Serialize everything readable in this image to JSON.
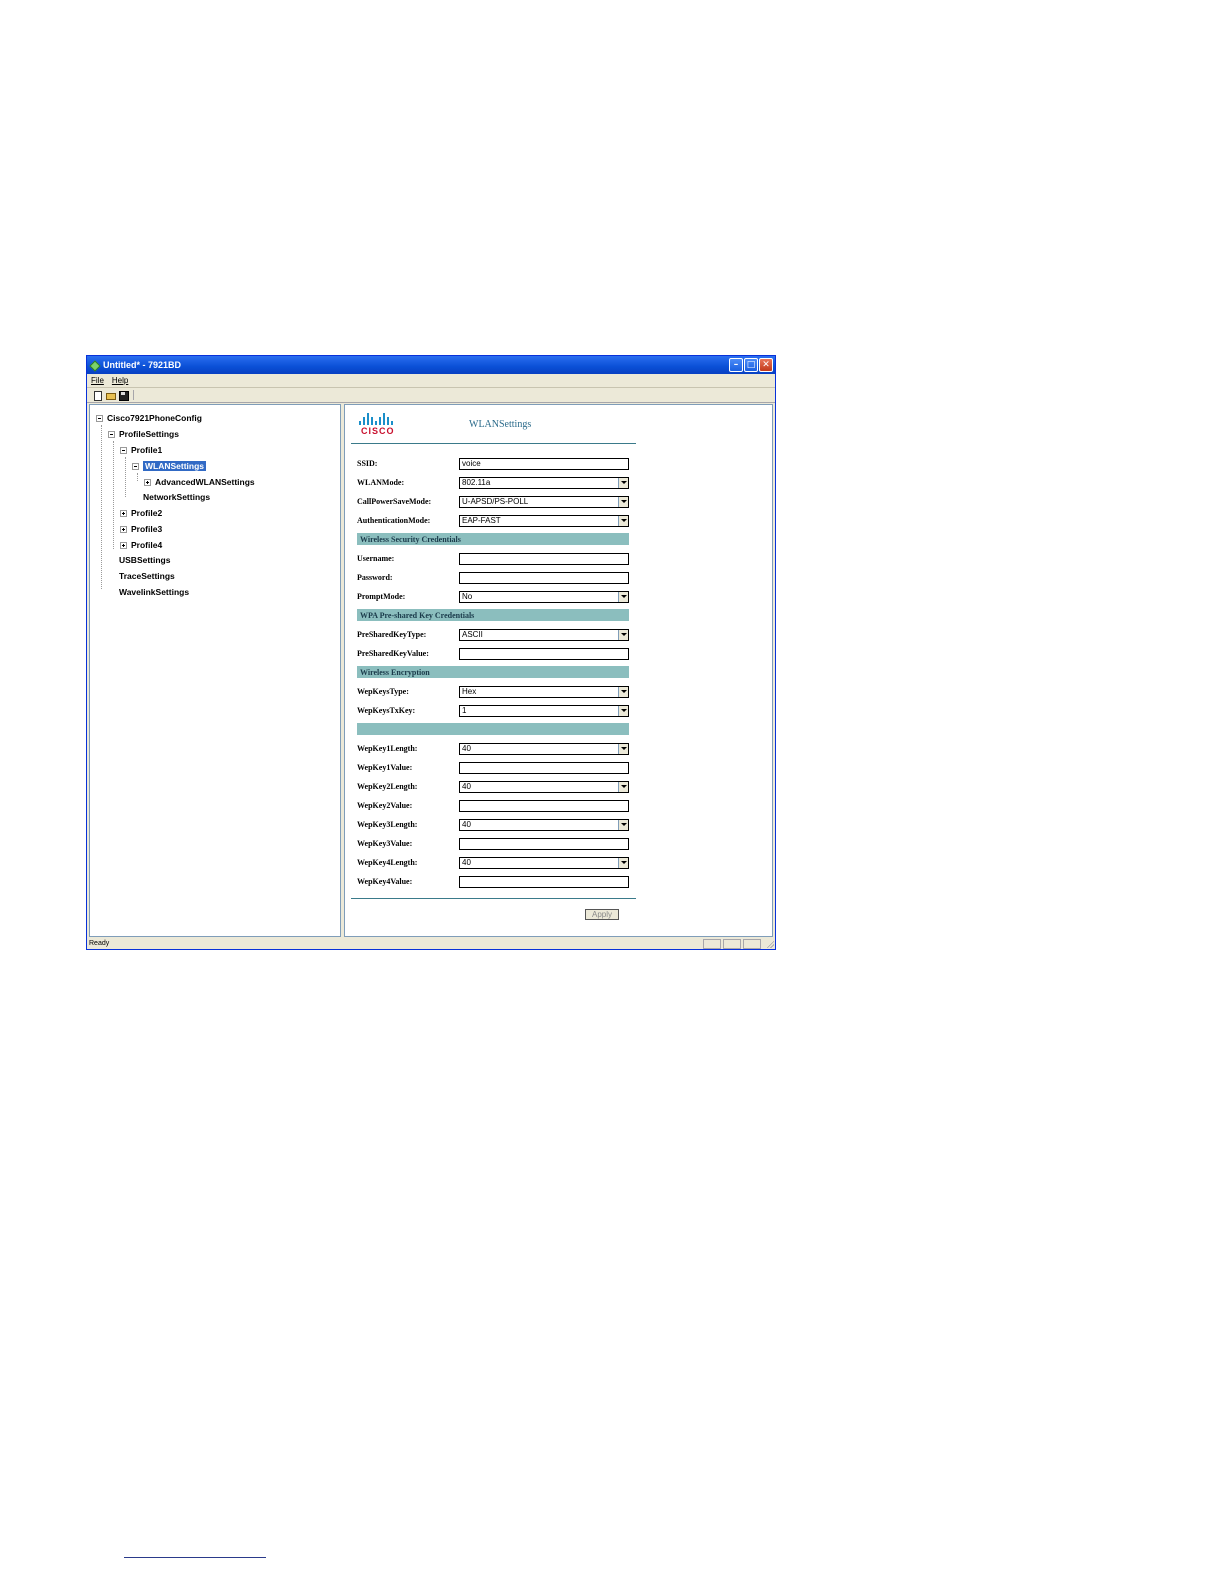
{
  "window": {
    "title": "Untitled* - 7921BD",
    "menu": [
      "File",
      "Help"
    ]
  },
  "tree": {
    "root": "Cisco7921PhoneConfig",
    "profile_settings": "ProfileSettings",
    "profile1": "Profile1",
    "wlan_settings": "WLANSettings",
    "advanced_wlan_settings": "AdvancedWLANSettings",
    "network_settings": "NetworkSettings",
    "profile2": "Profile2",
    "profile3": "Profile3",
    "profile4": "Profile4",
    "usb_settings": "USBSettings",
    "trace_settings": "TraceSettings",
    "wavelink_settings": "WavelinkSettings"
  },
  "content": {
    "logo_text": "CISCO",
    "page_title": "WLANSettings",
    "fields": {
      "ssid": {
        "label": "SSID:",
        "value": "voice"
      },
      "wlan_mode": {
        "label": "WLANMode:",
        "value": "802.11a"
      },
      "call_power_save_mode": {
        "label": "CallPowerSaveMode:",
        "value": "U-APSD/PS-POLL"
      },
      "authentication_mode": {
        "label": "AuthenticationMode:",
        "value": "EAP-FAST"
      },
      "username": {
        "label": "Username:",
        "value": ""
      },
      "password": {
        "label": "Password:",
        "value": ""
      },
      "prompt_mode": {
        "label": "PromptMode:",
        "value": "No"
      },
      "psk_type": {
        "label": "PreSharedKeyType:",
        "value": "ASCII"
      },
      "psk_value": {
        "label": "PreSharedKeyValue:",
        "value": ""
      },
      "wep_keys_type": {
        "label": "WepKeysType:",
        "value": "Hex"
      },
      "wep_keys_tx_key": {
        "label": "WepKeysTxKey:",
        "value": "1"
      },
      "wep_key1_length": {
        "label": "WepKey1Length:",
        "value": "40"
      },
      "wep_key1_value": {
        "label": "WepKey1Value:",
        "value": ""
      },
      "wep_key2_length": {
        "label": "WepKey2Length:",
        "value": "40"
      },
      "wep_key2_value": {
        "label": "WepKey2Value:",
        "value": ""
      },
      "wep_key3_length": {
        "label": "WepKey3Length:",
        "value": "40"
      },
      "wep_key3_value": {
        "label": "WepKey3Value:",
        "value": ""
      },
      "wep_key4_length": {
        "label": "WepKey4Length:",
        "value": "40"
      },
      "wep_key4_value": {
        "label": "WepKey4Value:",
        "value": ""
      }
    },
    "sections": {
      "wireless_security": "Wireless Security Credentials",
      "wpa_psk": "WPA Pre-shared Key Credentials",
      "wireless_encryption": "Wireless Encryption",
      "blank": ""
    },
    "apply_label": "Apply"
  },
  "status": {
    "text": "Ready"
  },
  "colors": {
    "titlebar": "#0a4fd6",
    "section": "#8bbebe",
    "selection": "#316ac5",
    "logo_red": "#c8102e",
    "logo_blue": "#1b8fc9"
  }
}
